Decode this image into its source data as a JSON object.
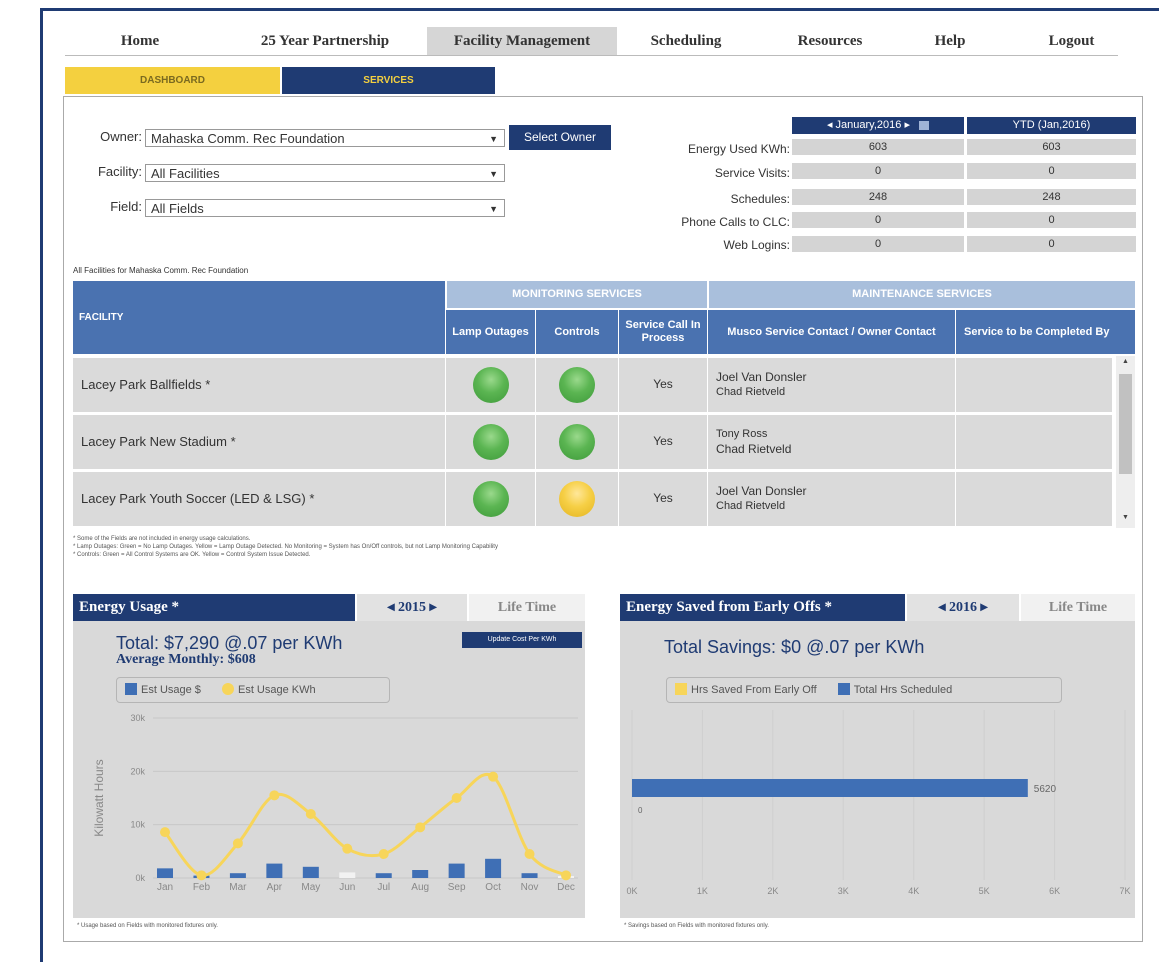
{
  "nav": {
    "items": [
      "Home",
      "25 Year Partnership",
      "Facility Management",
      "Scheduling",
      "Resources",
      "Help",
      "Logout"
    ],
    "active": "Facility Management"
  },
  "subtabs": {
    "dashboard": "DASHBOARD",
    "services": "SERVICES"
  },
  "filters": {
    "owner_label": "Owner:",
    "owner_value": "Mahaska Comm. Rec Foundation",
    "select_owner_button": "Select Owner",
    "facility_label": "Facility:",
    "facility_value": "All Facilities",
    "field_label": "Field:",
    "field_value": "All Fields"
  },
  "stats": {
    "period_header": "◂ January,2016 ▸",
    "ytd_header": "YTD (Jan,2016)",
    "rows": [
      {
        "label": "Energy Used KWh:",
        "period": "603",
        "ytd": "603"
      },
      {
        "label": "Service Visits:",
        "period": "0",
        "ytd": "0"
      },
      {
        "label": "Schedules:",
        "period": "248",
        "ytd": "248"
      },
      {
        "label": "Phone Calls to CLC:",
        "period": "0",
        "ytd": "0"
      },
      {
        "label": "Web Logins:",
        "period": "0",
        "ytd": "0"
      }
    ]
  },
  "table": {
    "caption": "All Facilities for Mahaska Comm. Rec Foundation",
    "facility_header": "FACILITY",
    "monitoring_header": "MONITORING SERVICES",
    "maintenance_header": "MAINTENANCE SERVICES",
    "col_lamp": "Lamp Outages",
    "col_controls": "Controls",
    "col_service_call": "Service Call In Process",
    "col_contact": "Musco Service Contact / Owner Contact",
    "col_completed": "Service to be Completed By",
    "rows": [
      {
        "facility": "Lacey Park Ballfields *",
        "lamp": "green",
        "controls": "green",
        "service_call": "Yes",
        "musco_contact": "Joel Van Donsler",
        "owner_contact": "Chad Rietveld"
      },
      {
        "facility": "Lacey Park New Stadium *",
        "lamp": "green",
        "controls": "green",
        "service_call": "Yes",
        "musco_contact": "Tony Ross",
        "owner_contact": "Chad Rietveld"
      },
      {
        "facility": "Lacey Park Youth Soccer (LED & LSG) *",
        "lamp": "green",
        "controls": "yellow",
        "service_call": "Yes",
        "musco_contact": "Joel Van Donsler",
        "owner_contact": "Chad Rietveld"
      }
    ],
    "notes": [
      "* Some of the Fields are not included in energy usage calculations.",
      "* Lamp Outages: Green = No Lamp Outages. Yellow = Lamp Outage Detected. No Monitoring = System has On/Off controls, but not Lamp Monitoring Capability",
      "* Controls: Green = All Control Systems are OK. Yellow = Control System Issue Detected."
    ]
  },
  "energy_usage": {
    "title": "Energy Usage *",
    "year_nav": "◂ 2015 ▸",
    "lifetime_tab": "Life Time",
    "total_text": "Total: $7,290 @.07 per KWh",
    "average_text": "Average Monthly: $608",
    "update_button": "Update Cost Per KWh",
    "footnote": "* Usage based on Fields with monitored fixtures only."
  },
  "energy_saved": {
    "title": "Energy Saved from Early Offs *",
    "year_nav": "◂ 2016 ▸",
    "lifetime_tab": "Life Time",
    "total_text": "Total Savings: $0 @.07 per KWh",
    "footnote": "* Savings based on Fields with monitored fixtures only."
  },
  "colors": {
    "navy": "#1f3b73",
    "gold": "#f4d03f",
    "bar_blue": "#3f6fb5",
    "line_yellow": "#f7d55a"
  },
  "chart_data": [
    {
      "type": "line",
      "ylabel": "Kilowatt Hours",
      "categories": [
        "Jan",
        "Feb",
        "Mar",
        "Apr",
        "May",
        "Jun",
        "Jul",
        "Aug",
        "Sep",
        "Oct",
        "Nov",
        "Dec"
      ],
      "y_ticks": [
        "0k",
        "10k",
        "20k",
        "30k"
      ],
      "ylim": [
        0,
        30000
      ],
      "legend": [
        "Est Usage $",
        "Est Usage KWh"
      ],
      "series": [
        {
          "name": "Est Usage $",
          "type": "bar",
          "values": [
            603,
            150,
            300,
            900,
            700,
            350,
            300,
            500,
            900,
            1200,
            300,
            100
          ]
        },
        {
          "name": "Est Usage KWh",
          "type": "line",
          "values": [
            8600,
            500,
            6500,
            15500,
            12000,
            5500,
            4500,
            9500,
            15000,
            19000,
            4500,
            500
          ]
        }
      ],
      "legend_position": "top"
    },
    {
      "type": "bar",
      "orientation": "horizontal",
      "x_ticks": [
        "0K",
        "1K",
        "2K",
        "3K",
        "4K",
        "5K",
        "6K",
        "7K"
      ],
      "xlim": [
        0,
        7000
      ],
      "legend": [
        "Hrs Saved From Early Off",
        "Total Hrs Scheduled"
      ],
      "series": [
        {
          "name": "Total Hrs Scheduled",
          "values": [
            5620
          ],
          "label": "5620"
        },
        {
          "name": "Hrs Saved From Early Off",
          "values": [
            0
          ],
          "label": "0"
        }
      ],
      "legend_position": "top"
    }
  ]
}
